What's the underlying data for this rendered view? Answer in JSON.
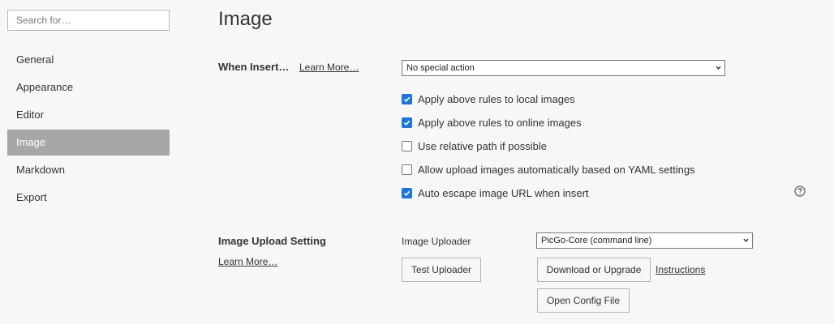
{
  "sidebar": {
    "search_placeholder": "Search for…",
    "items": [
      {
        "label": "General"
      },
      {
        "label": "Appearance"
      },
      {
        "label": "Editor"
      },
      {
        "label": "Image"
      },
      {
        "label": "Markdown"
      },
      {
        "label": "Export"
      }
    ],
    "active": "Image"
  },
  "main": {
    "title": "Image",
    "when_insert": {
      "label": "When Insert…",
      "learn_more": "Learn More…",
      "selected": "No special action"
    },
    "options": [
      {
        "label": "Apply above rules to local images",
        "checked": true
      },
      {
        "label": "Apply above rules to online images",
        "checked": true
      },
      {
        "label": "Use relative path if possible",
        "checked": false
      },
      {
        "label": "Allow upload images automatically based on YAML settings",
        "checked": false
      },
      {
        "label": "Auto escape image URL when insert",
        "checked": true
      }
    ],
    "upload": {
      "label": "Image Upload Setting",
      "learn_more": "Learn More…",
      "uploader_label": "Image Uploader",
      "uploader_selected": "PicGo-Core (command line)",
      "test_button": "Test Uploader",
      "download_button": "Download or Upgrade",
      "instructions_link": "Instructions",
      "open_config_button": "Open Config File"
    }
  },
  "colors": {
    "accent": "#1a73e8",
    "active_nav_bg": "#a7a7a7",
    "background": "#f7f7f7"
  },
  "icons": {
    "help": "question-circle-icon",
    "check": "checkmark-icon",
    "dropdown": "chevron-down-icon"
  }
}
